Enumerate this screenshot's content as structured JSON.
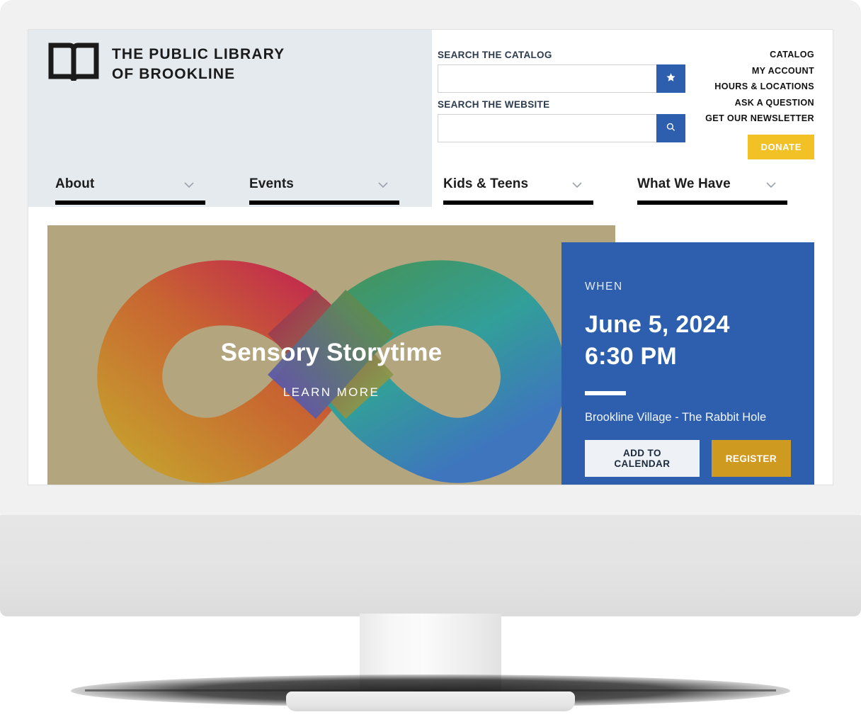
{
  "brand": {
    "logo_icon": "open-book-icon",
    "name_line1": "THE PUBLIC LIBRARY",
    "name_line2": "OF BROOKLINE"
  },
  "search": {
    "catalog": {
      "label": "SEARCH THE CATALOG",
      "value": "",
      "placeholder": "",
      "button_icon": "star-icon"
    },
    "website": {
      "label": "SEARCH THE WEBSITE",
      "value": "",
      "placeholder": "",
      "button_icon": "search-icon"
    }
  },
  "utility_nav": {
    "links": [
      {
        "label": "CATALOG"
      },
      {
        "label": "MY ACCOUNT"
      },
      {
        "label": "HOURS & LOCATIONS"
      },
      {
        "label": "ASK A QUESTION"
      },
      {
        "label": "GET OUR NEWSLETTER"
      }
    ],
    "donate_label": "DONATE"
  },
  "main_nav": {
    "items": [
      {
        "label": "About"
      },
      {
        "label": "Events"
      },
      {
        "label": "Kids & Teens"
      },
      {
        "label": "What We Have"
      }
    ],
    "chevron_icon": "chevron-down-icon"
  },
  "hero": {
    "title": "Sensory Storytime",
    "cta": "LEARN MORE",
    "background_color": "#b3a67f",
    "graphic": "infinity-loop-gradient"
  },
  "event": {
    "when_label": "WHEN",
    "date": "June 5, 2024",
    "time": "6:30 PM",
    "location": "Brookline Village - The Rabbit Hole",
    "panel_color": "#2d5fae",
    "actions": [
      {
        "label": "ADD TO CALENDAR"
      },
      {
        "label": "REGISTER"
      }
    ]
  },
  "colors": {
    "accent_blue": "#2d5fae",
    "donate_yellow": "#f2c125",
    "header_gray": "#e5eaee",
    "hero_tan": "#b3a67f"
  }
}
